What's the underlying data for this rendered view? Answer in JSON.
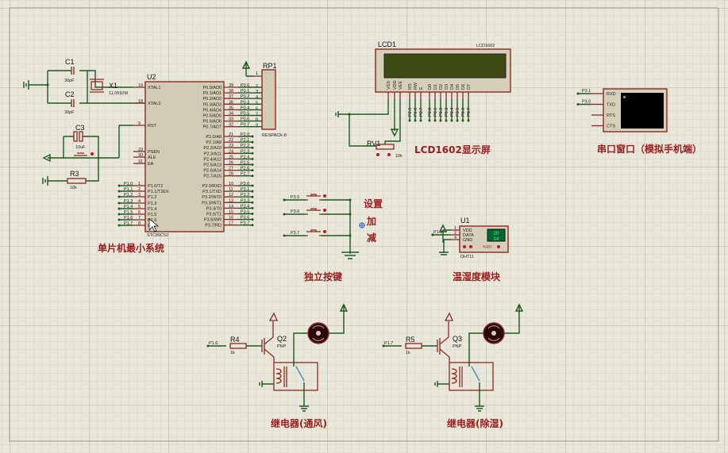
{
  "app": "Proteus ISIS schematic",
  "colors": {
    "wire": "#1e5a1e",
    "component": "#8b2a22",
    "label": "#9a1e1e",
    "lcd_screen": "#3e4a14",
    "terminal_screen": "#000000"
  },
  "mcu": {
    "ref": "U2",
    "part": "STC89C52",
    "left_pins": [
      {
        "num": "19",
        "name": "XTAL1"
      },
      {
        "num": "18",
        "name": "XTAL2"
      },
      {
        "num": "9",
        "name": "RST"
      },
      {
        "num": "29",
        "name": "PSEN"
      },
      {
        "num": "30",
        "name": "ALE"
      },
      {
        "num": "31",
        "name": "EA"
      },
      {
        "num": "1",
        "name": "P1.0/T2",
        "net": "P1.0"
      },
      {
        "num": "2",
        "name": "P1.1/T2EX",
        "net": "P1.1"
      },
      {
        "num": "3",
        "name": "P1.2",
        "net": "P1.2"
      },
      {
        "num": "4",
        "name": "P1.3",
        "net": "P1.3"
      },
      {
        "num": "5",
        "name": "P1.4",
        "net": "P1.4"
      },
      {
        "num": "6",
        "name": "P1.5",
        "net": "P1.5"
      },
      {
        "num": "7",
        "name": "P1.6",
        "net": "P1.6"
      },
      {
        "num": "8",
        "name": "P1.7",
        "net": "P1.7"
      }
    ],
    "right_pins": [
      {
        "num": "39",
        "name": "P0.0/AD0",
        "net": "P0.0"
      },
      {
        "num": "38",
        "name": "P0.1/AD1",
        "net": "P0.1"
      },
      {
        "num": "37",
        "name": "P0.2/AD2",
        "net": "P0.2"
      },
      {
        "num": "36",
        "name": "P0.3/AD3",
        "net": "P0.3"
      },
      {
        "num": "35",
        "name": "P0.4/AD4",
        "net": "P0.4"
      },
      {
        "num": "34",
        "name": "P0.5/AD5",
        "net": "P0.5"
      },
      {
        "num": "33",
        "name": "P0.6/AD6",
        "net": "P0.6"
      },
      {
        "num": "32",
        "name": "P0.7/AD7",
        "net": "P0.7"
      },
      {
        "num": "21",
        "name": "P2.0/A8",
        "net": "P2.0"
      },
      {
        "num": "22",
        "name": "P2.1/A9",
        "net": "P2.1"
      },
      {
        "num": "23",
        "name": "P2.2/A10",
        "net": "P2.2"
      },
      {
        "num": "24",
        "name": "P2.3/A11",
        "net": "P2.3"
      },
      {
        "num": "25",
        "name": "P2.4/A12",
        "net": "P2.4"
      },
      {
        "num": "26",
        "name": "P2.5/A13",
        "net": "P2.5"
      },
      {
        "num": "27",
        "name": "P2.6/A14",
        "net": "P2.6"
      },
      {
        "num": "28",
        "name": "P2.7/A15",
        "net": "P2.7"
      },
      {
        "num": "10",
        "name": "P3.0/RXD",
        "net": "P3.0"
      },
      {
        "num": "11",
        "name": "P3.1/TXD",
        "net": "P3.1"
      },
      {
        "num": "12",
        "name": "P3.2/INT0",
        "net": "P3.2"
      },
      {
        "num": "13",
        "name": "P3.3/INT1",
        "net": "P3.3"
      },
      {
        "num": "14",
        "name": "P3.4/T0",
        "net": "P3.4"
      },
      {
        "num": "15",
        "name": "P3.5/T1",
        "net": "P3.5"
      },
      {
        "num": "16",
        "name": "P3.6/WR",
        "net": "P3.6"
      },
      {
        "num": "17",
        "name": "P3.7/RD",
        "net": "P3.7"
      }
    ]
  },
  "parts": {
    "c1": {
      "ref": "C1",
      "value": "30pF"
    },
    "c2": {
      "ref": "C2",
      "value": "30pF"
    },
    "x1": {
      "ref": "X1",
      "value": "11.0592M"
    },
    "c3": {
      "ref": "C3",
      "value": "10uF"
    },
    "r3": {
      "ref": "R3",
      "value": "10k"
    },
    "rp1": {
      "ref": "RP1",
      "value": "RESPACK-8",
      "pins": [
        "1",
        "2",
        "3",
        "4",
        "5",
        "6",
        "7",
        "8",
        "9"
      ]
    },
    "lcd": {
      "ref": "LCD1",
      "part": "LCD1602",
      "pins": [
        "VSS",
        "VDD",
        "VEE",
        "RS",
        "RW",
        "E",
        "D0",
        "D1",
        "D2",
        "D3",
        "D4",
        "D5",
        "D6",
        "D7"
      ],
      "nets": [
        "P2.5",
        "P2.6",
        "P2.7",
        "P0.0",
        "P0.1",
        "P0.2",
        "P0.3",
        "P0.4",
        "P0.5",
        "P0.6",
        "P0.7"
      ]
    },
    "rv1": {
      "ref": "RV1",
      "value": "10k"
    },
    "buttons": [
      {
        "net": "P3.5"
      },
      {
        "net": "P3.6"
      },
      {
        "net": "P3.7"
      }
    ],
    "dht": {
      "ref": "U1",
      "part": "DHT11",
      "pins": [
        "VDD",
        "DATA",
        "GND"
      ],
      "pin_nums": [
        "1",
        "2",
        "4"
      ],
      "net": "P1.0",
      "reading_top": "20",
      "reading_bottom": "14",
      "unit": "%RH"
    },
    "terminal": {
      "pins": [
        "RXD",
        "TXD",
        "RTS",
        "CTS"
      ],
      "nets": [
        "P3.1",
        "P3.0"
      ]
    },
    "relay1": {
      "net": "P1.6",
      "r_ref": "R4",
      "r_value": "1k",
      "q_ref": "Q2",
      "q_type": "PNP"
    },
    "relay2": {
      "net": "P1.7",
      "r_ref": "R5",
      "r_value": "1k",
      "q_ref": "Q3",
      "q_type": "PNP"
    }
  },
  "labels": {
    "mcu_block": "单片机最小系统",
    "lcd_block": "LCD1602显示屏",
    "serial_block": "串口窗口（模拟手机端）",
    "buttons_block": "独立按键",
    "btn_set": "设置",
    "btn_add": "加",
    "btn_sub": "减",
    "dht_block": "温湿度模块",
    "relay1_block": "继电器(通风)",
    "relay2_block": "继电器(除湿)"
  }
}
